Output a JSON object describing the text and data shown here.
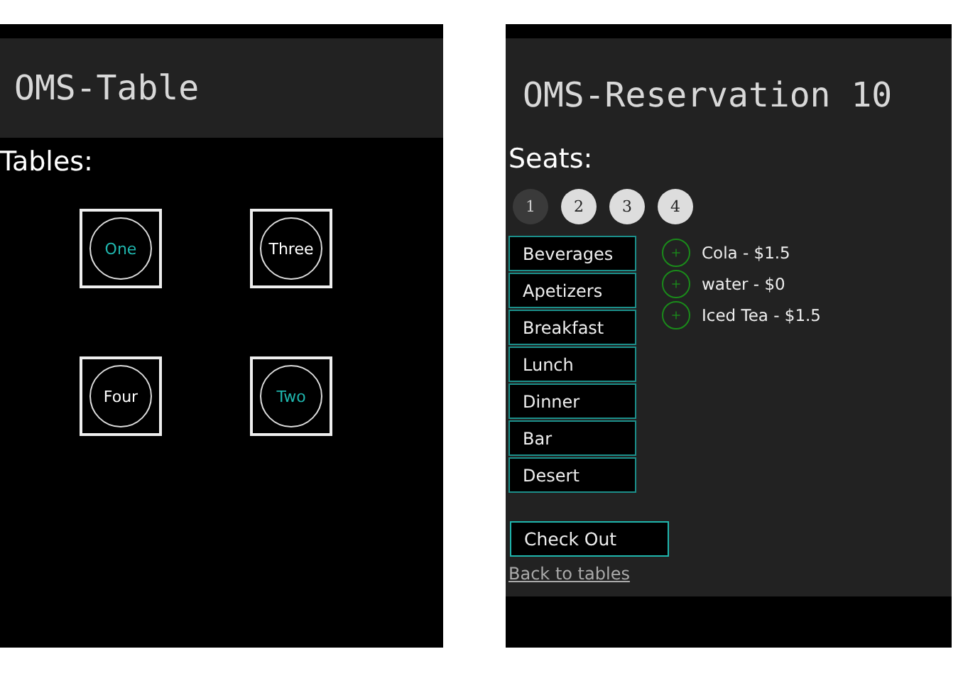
{
  "table_screen": {
    "title": "OMS-Table",
    "heading": "Tables:",
    "tables": [
      {
        "label": "One",
        "color": "#1fb5ad"
      },
      {
        "label": "Three",
        "color": "#ffffff"
      },
      {
        "label": "Four",
        "color": "#ffffff"
      },
      {
        "label": "Two",
        "color": "#1fb5ad"
      }
    ]
  },
  "reservation_screen": {
    "title": "OMS-Reservation 10",
    "heading": "Seats:",
    "seats": [
      {
        "label": "1",
        "selected": true
      },
      {
        "label": "2",
        "selected": false
      },
      {
        "label": "3",
        "selected": false
      },
      {
        "label": "4",
        "selected": false
      }
    ],
    "categories": [
      "Beverages",
      "Apetizers",
      "Breakfast",
      "Lunch",
      "Dinner",
      "Bar",
      "Desert"
    ],
    "items": [
      "Cola - $1.5",
      "water - $0",
      "Iced Tea - $1.5"
    ],
    "checkout_button": "Check Out",
    "back_link": "Back to tables"
  }
}
